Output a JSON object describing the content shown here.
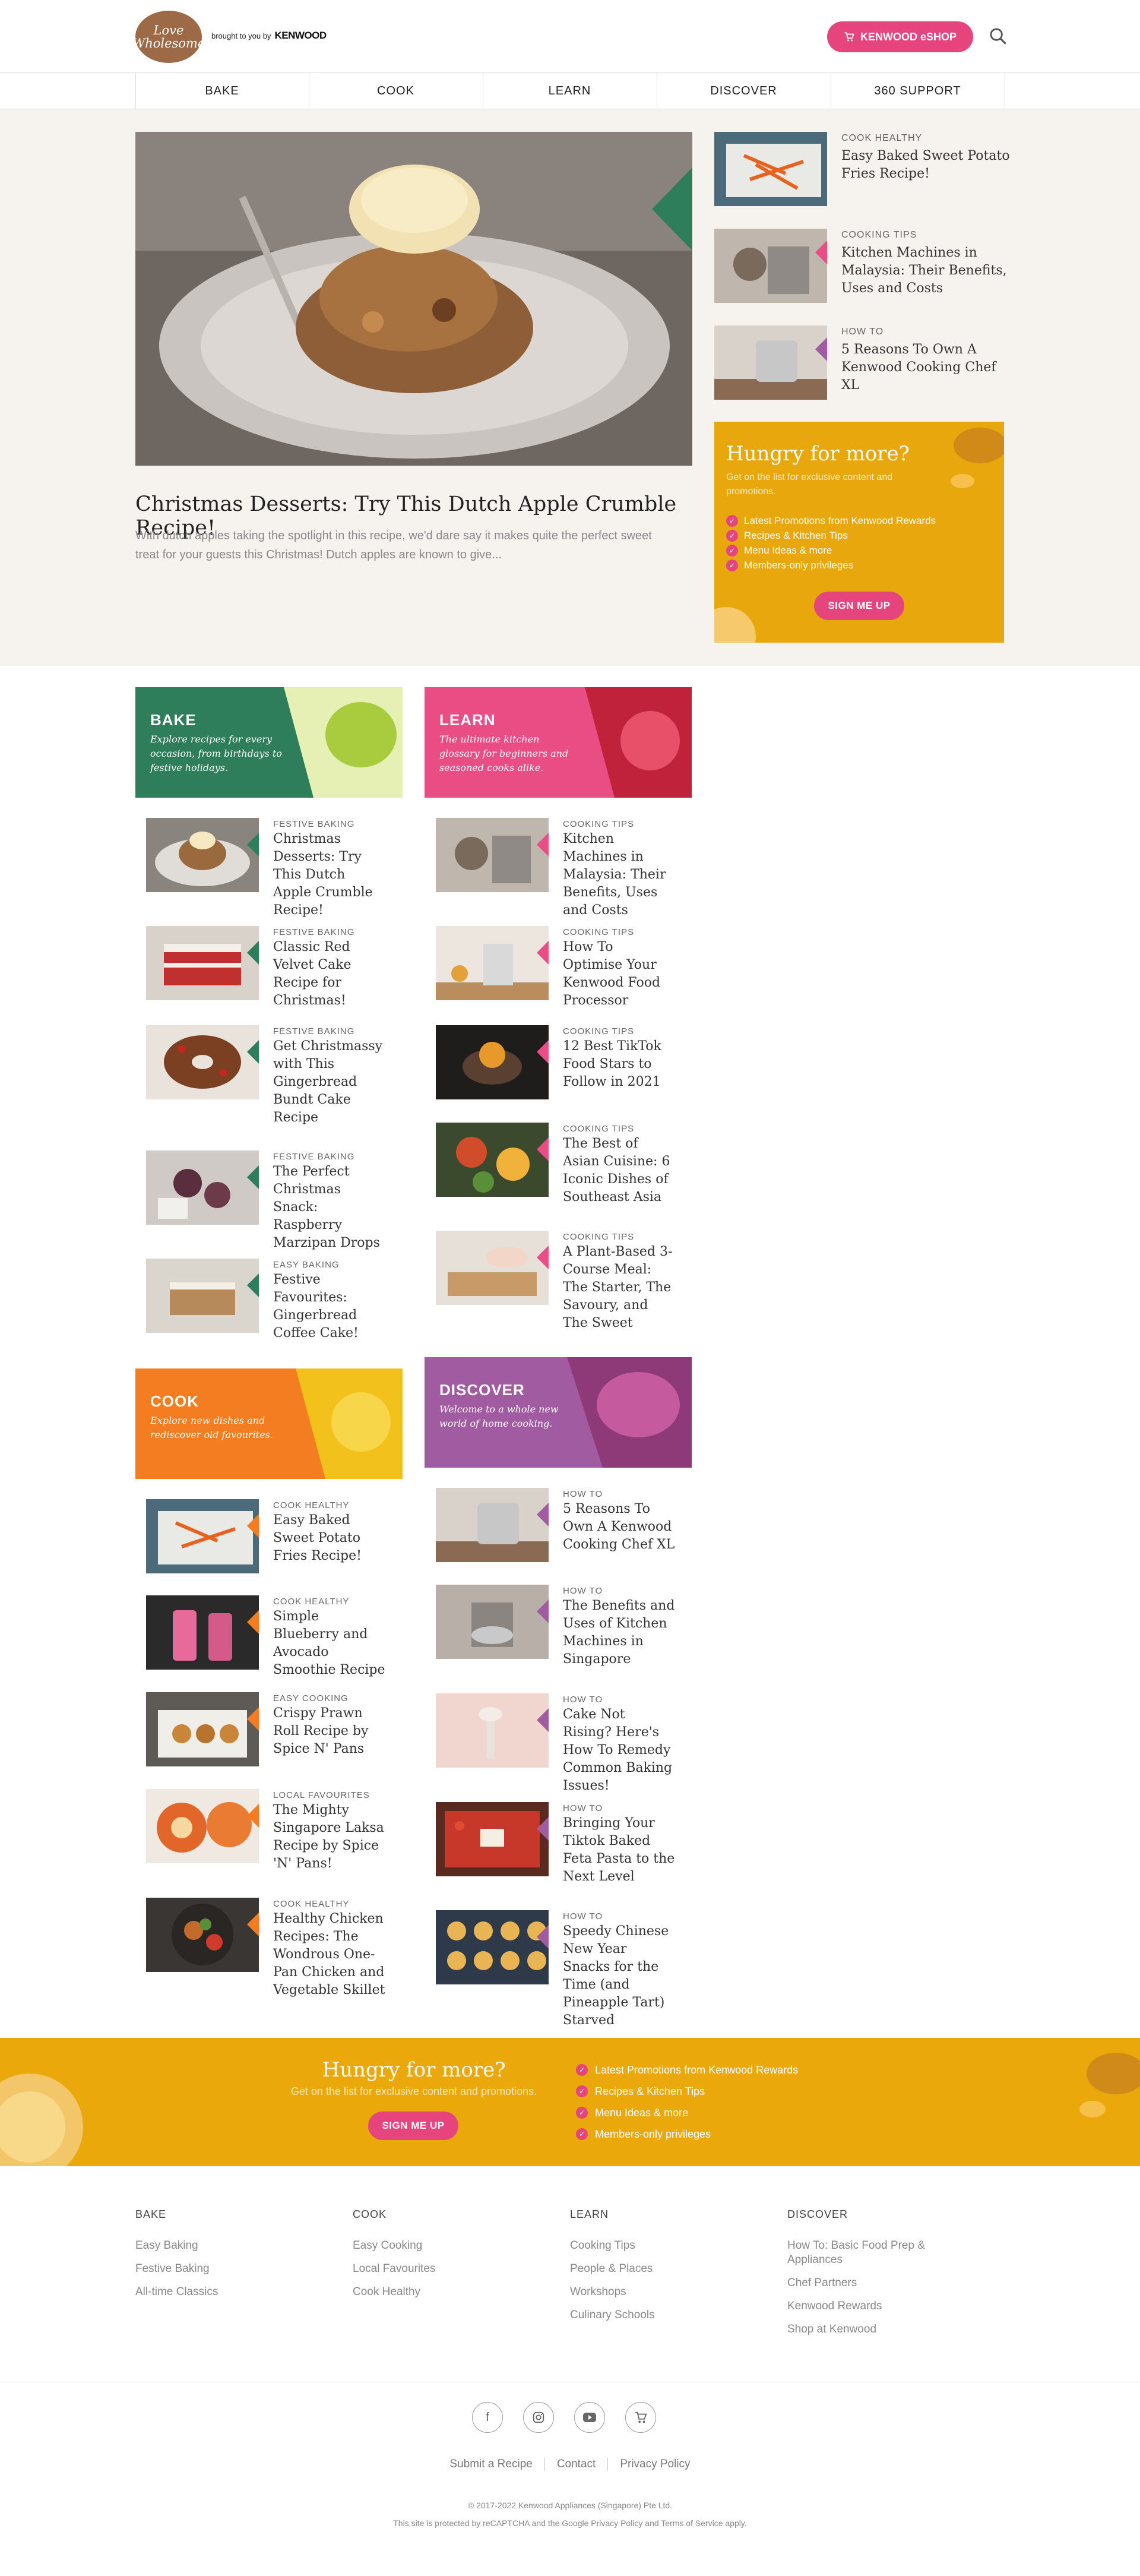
{
  "header": {
    "logo_text": "Love Wholesome",
    "brought_by": "brought to you by",
    "brand": "KENWOOD",
    "eshop_label": "KENWOOD eSHOP"
  },
  "nav": [
    "BAKE",
    "COOK",
    "LEARN",
    "DISCOVER",
    "360 SUPPORT"
  ],
  "hero": {
    "title": "Christmas Desserts: Try This Dutch Apple Crumble Recipe!",
    "excerpt": "With dutch apples taking the spotlight in this recipe, we'd dare say it makes quite the perfect sweet treat for your guests this Christmas!  Dutch apples are known to give..."
  },
  "side_articles": [
    {
      "category": "COOK HEALTHY",
      "title": "Easy Baked Sweet Potato Fries Recipe!"
    },
    {
      "category": "COOKING TIPS",
      "title": "Kitchen Machines in Malaysia: Their Benefits, Uses and Costs"
    },
    {
      "category": "HOW TO",
      "title": "5 Reasons To Own A Kenwood Cooking Chef XL"
    }
  ],
  "promo": {
    "title": "Hungry for more?",
    "subtitle": "Get on the list for exclusive content and promotions.",
    "perks": [
      "Latest Promotions from Kenwood Rewards",
      "Recipes & Kitchen Tips",
      "Menu Ideas & more",
      "Members-only privileges"
    ],
    "signup_label": "SIGN ME UP"
  },
  "categories": {
    "bake": {
      "label": "BAKE",
      "desc": "Explore recipes for every occasion, from birthdays to festive holidays.",
      "color": "#2e7d5b",
      "items": [
        {
          "category": "FESTIVE BAKING",
          "title": "Christmas Desserts: Try This Dutch Apple Crumble Recipe!"
        },
        {
          "category": "FESTIVE BAKING",
          "title": "Classic Red Velvet Cake Recipe for Christmas!"
        },
        {
          "category": "FESTIVE BAKING",
          "title": "Get Christmassy with This Gingerbread Bundt Cake Recipe"
        },
        {
          "category": "FESTIVE BAKING",
          "title": "The Perfect Christmas Snack: Raspberry Marzipan Drops"
        },
        {
          "category": "EASY BAKING",
          "title": "Festive Favourites: Gingerbread Coffee Cake!"
        }
      ]
    },
    "learn": {
      "label": "LEARN",
      "desc": "The ultimate kitchen glossary for beginners and seasoned cooks alike.",
      "color": "#ea4d84",
      "items": [
        {
          "category": "COOKING TIPS",
          "title": "Kitchen Machines in Malaysia: Their Benefits, Uses and Costs"
        },
        {
          "category": "COOKING TIPS",
          "title": "How To Optimise Your Kenwood Food Processor"
        },
        {
          "category": "COOKING TIPS",
          "title": "12 Best TikTok Food Stars to Follow in 2021"
        },
        {
          "category": "COOKING TIPS",
          "title": "The Best of Asian Cuisine: 6 Iconic Dishes of Southeast Asia"
        },
        {
          "category": "COOKING TIPS",
          "title": "A Plant-Based 3-Course Meal: The Starter, The Savoury, and The Sweet"
        }
      ]
    },
    "cook": {
      "label": "COOK",
      "desc": "Explore new dishes and rediscover old favourites.",
      "color": "#f47c21",
      "items": [
        {
          "category": "COOK HEALTHY",
          "title": "Easy Baked Sweet Potato Fries Recipe!"
        },
        {
          "category": "COOK HEALTHY",
          "title": "Simple Blueberry and Avocado Smoothie Recipe"
        },
        {
          "category": "EASY COOKING",
          "title": "Crispy Prawn Roll Recipe by Spice N' Pans"
        },
        {
          "category": "LOCAL FAVOURITES",
          "title": "The Mighty Singapore Laksa Recipe by Spice 'N' Pans!"
        },
        {
          "category": "COOK HEALTHY",
          "title": "Healthy Chicken Recipes: The Wondrous One-Pan Chicken and Vegetable Skillet"
        }
      ]
    },
    "discover": {
      "label": "DISCOVER",
      "desc": "Welcome to a whole new world of home cooking.",
      "color": "#a15ba0",
      "items": [
        {
          "category": "HOW TO",
          "title": "5 Reasons To Own A Kenwood Cooking Chef XL"
        },
        {
          "category": "HOW TO",
          "title": "The Benefits and Uses of Kitchen Machines in Singapore"
        },
        {
          "category": "HOW TO",
          "title": "Cake Not Rising? Here's How To Remedy Common Baking Issues!"
        },
        {
          "category": "HOW TO",
          "title": "Bringing Your Tiktok Baked Feta Pasta to the Next Level"
        },
        {
          "category": "HOW TO",
          "title": "Speedy Chinese New Year Snacks for the Time (and Pineapple Tart) Starved"
        }
      ]
    }
  },
  "band": {
    "title": "Hungry for more?",
    "subtitle": "Get on the list for exclusive content and promotions.",
    "perks": [
      "Latest Promotions from Kenwood Rewards",
      "Recipes & Kitchen Tips",
      "Menu Ideas & more",
      "Members-only privileges"
    ],
    "signup_label": "SIGN ME UP"
  },
  "footer": {
    "columns": [
      {
        "heading": "BAKE",
        "links": [
          "Easy Baking",
          "Festive Baking",
          "All-time Classics"
        ]
      },
      {
        "heading": "COOK",
        "links": [
          "Easy Cooking",
          "Local Favourites",
          "Cook Healthy"
        ]
      },
      {
        "heading": "LEARN",
        "links": [
          "Cooking Tips",
          "People & Places",
          "Workshops",
          "Culinary Schools"
        ]
      },
      {
        "heading": "DISCOVER",
        "links": [
          "How To: Basic Food Prep & Appliances",
          "Chef Partners",
          "Kenwood Rewards",
          "Shop at Kenwood"
        ]
      }
    ],
    "links": [
      "Submit a Recipe",
      "Contact",
      "Privacy Policy"
    ],
    "copyright": "© 2017-2022 Kenwood Appliances (Singapore) Pte Ltd.",
    "recaptcha": "This site is protected by reCAPTCHA and the Google Privacy Policy and Terms of Service apply."
  }
}
